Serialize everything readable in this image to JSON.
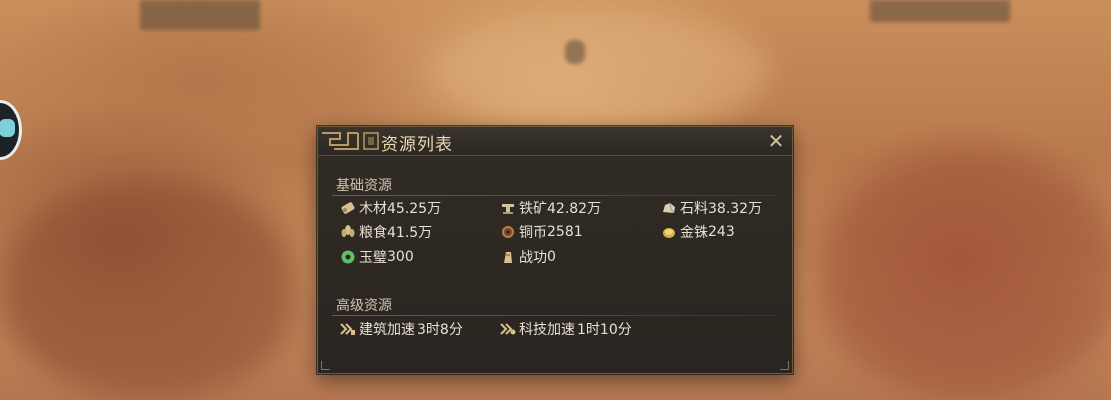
{
  "dialog": {
    "title": "资源列表",
    "close_symbol": "✕"
  },
  "basic": {
    "label": "基础资源",
    "items": [
      {
        "name": "木材",
        "value": "45.25万",
        "icon": "wood-icon"
      },
      {
        "name": "铁矿",
        "value": "42.82万",
        "icon": "iron-icon"
      },
      {
        "name": "石料",
        "value": "38.32万",
        "icon": "stone-icon"
      },
      {
        "name": "粮食",
        "value": "41.5万",
        "icon": "grain-icon"
      },
      {
        "name": "铜币",
        "value": "2581",
        "icon": "copper-coin-icon"
      },
      {
        "name": "金铢",
        "value": "243",
        "icon": "gold-coin-icon"
      },
      {
        "name": "玉璧",
        "value": "300",
        "icon": "jade-icon"
      },
      {
        "name": "战功",
        "value": "0",
        "icon": "merit-icon"
      }
    ]
  },
  "advanced": {
    "label": "高级资源",
    "items": [
      {
        "name": "建筑加速",
        "value": "3时8分",
        "icon": "build-speedup-icon"
      },
      {
        "name": "科技加速",
        "value": "1时10分",
        "icon": "tech-speedup-icon"
      }
    ]
  },
  "colors": {
    "title": "#e9d8b0",
    "text": "#e6e0d2",
    "panel": "#2c2823",
    "border": "#6b5a40"
  }
}
